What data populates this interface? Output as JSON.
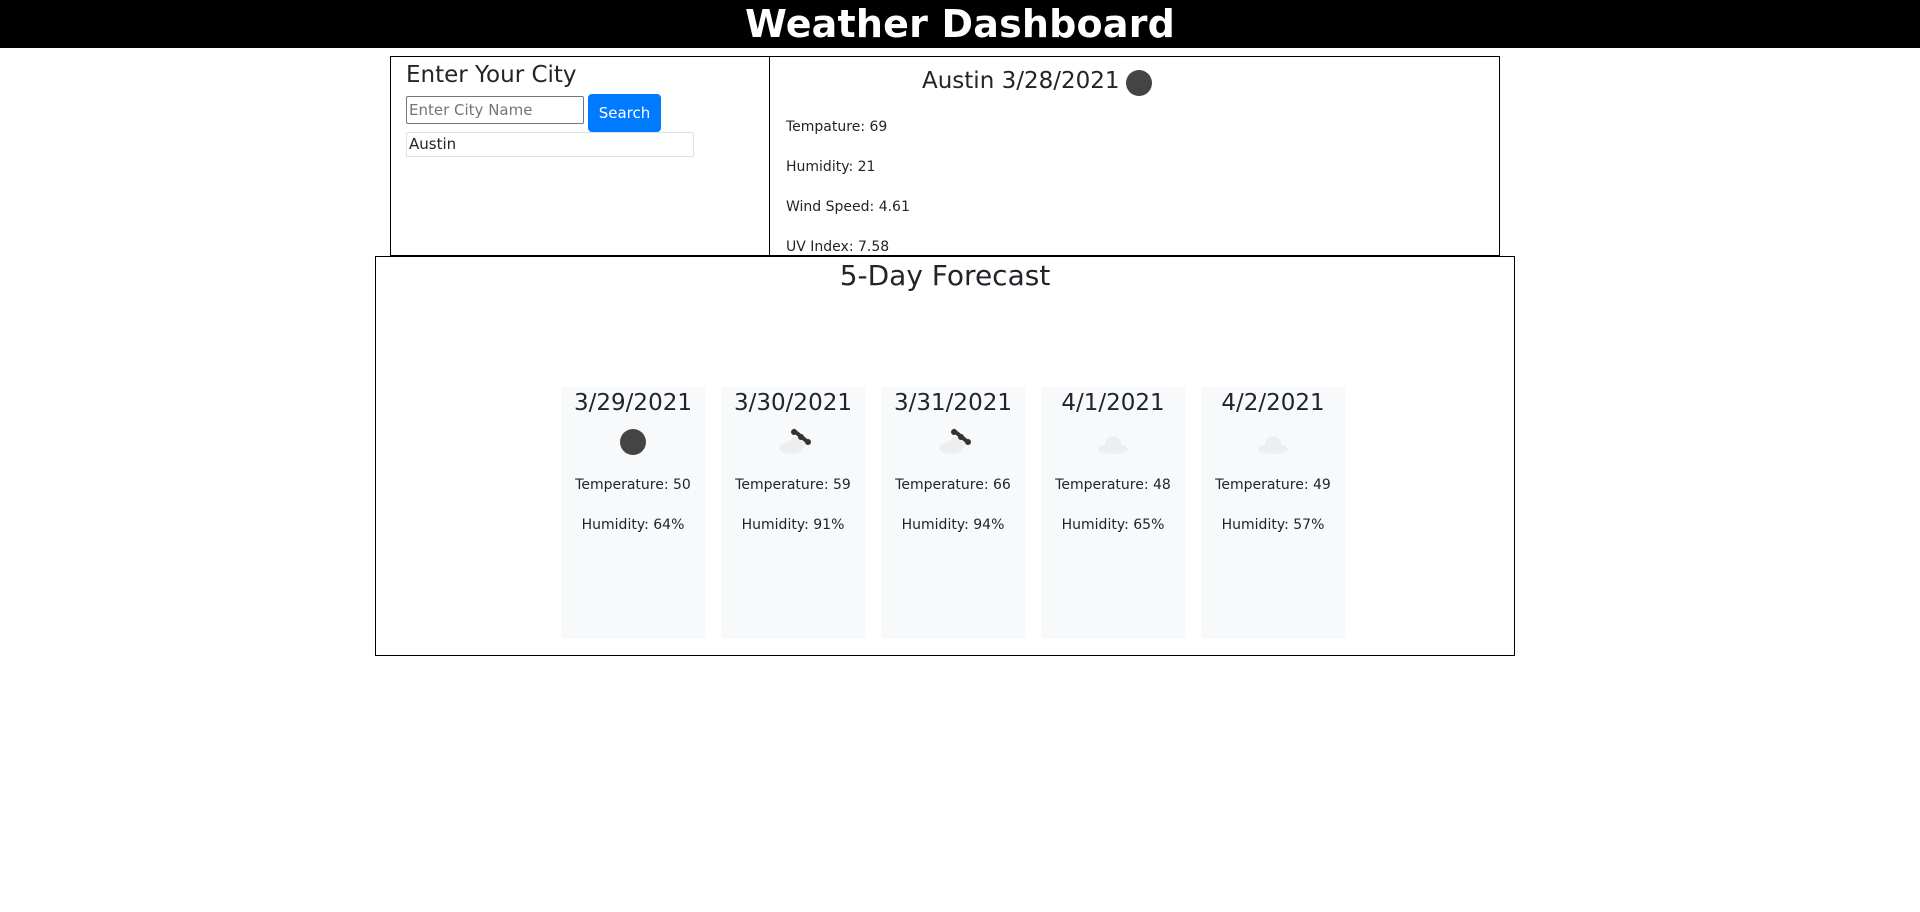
{
  "header": {
    "title": "Weather Dashboard"
  },
  "search": {
    "heading": "Enter Your City",
    "placeholder": "Enter City Name",
    "value": "",
    "button_label": "Search",
    "history": [
      "Austin"
    ]
  },
  "current": {
    "title": "Austin 3/28/2021",
    "icon": "clear-sky-icon",
    "temperature": "Tempature: 69",
    "humidity": "Humidity: 21",
    "wind": "Wind Speed: 4.61",
    "uv": "UV Index: 7.58"
  },
  "forecast": {
    "heading": "5-Day Forecast",
    "days": [
      {
        "date": "3/29/2021",
        "icon": "clear-sky-icon",
        "temperature": "Temperature: 50",
        "humidity": "Humidity: 64%"
      },
      {
        "date": "3/30/2021",
        "icon": "rain-icon",
        "temperature": "Temperature: 59",
        "humidity": "Humidity: 91%"
      },
      {
        "date": "3/31/2021",
        "icon": "rain-icon",
        "temperature": "Temperature: 66",
        "humidity": "Humidity: 94%"
      },
      {
        "date": "4/1/2021",
        "icon": "cloud-icon",
        "temperature": "Temperature: 48",
        "humidity": "Humidity: 65%"
      },
      {
        "date": "4/2/2021",
        "icon": "cloud-icon",
        "temperature": "Temperature: 49",
        "humidity": "Humidity: 57%"
      }
    ]
  },
  "colors": {
    "header_bg": "#000000",
    "button_bg": "#007bff",
    "card_bg": "#f8f9fa"
  }
}
